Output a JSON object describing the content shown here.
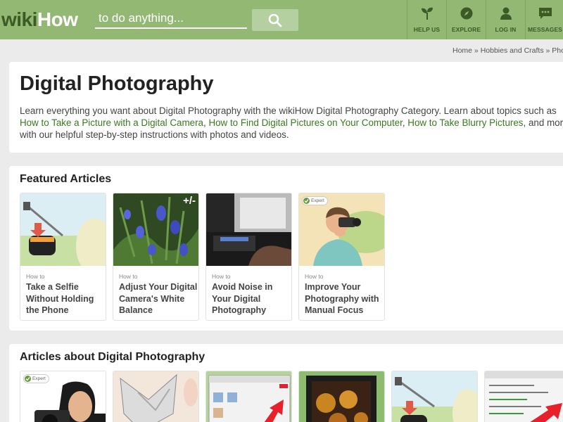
{
  "header": {
    "logo_wiki": "wiki",
    "logo_how": "How",
    "search_placeholder": "to do anything...",
    "nav": [
      {
        "label": "HELP US",
        "icon": "sprout-icon"
      },
      {
        "label": "EXPLORE",
        "icon": "compass-icon"
      },
      {
        "label": "LOG IN",
        "icon": "user-icon"
      },
      {
        "label": "MESSAGES",
        "icon": "chat-icon"
      }
    ]
  },
  "breadcrumb": {
    "home": "Home",
    "sep1": " » ",
    "hobbies": "Hobbies and Crafts",
    "sep2": " » ",
    "current": "Photogr"
  },
  "intro": {
    "title": "Digital Photography",
    "text_1": "Learn everything you want about Digital Photography with the wikiHow Digital Photography Category. Learn about topics such as ",
    "link_1": "How to Take a Picture with a Digital Camera",
    "text_2": ", ",
    "link_2": "How to Find Digital Pictures on Your Computer",
    "text_3": ", ",
    "link_3": "How to Take Blurry Pictures",
    "text_4": ", and more with our helpful step-by-step instructions with photos and videos."
  },
  "featured": {
    "title": "Featured Articles",
    "howto_label": "How to",
    "items": [
      {
        "title": "Take a Selfie Without Holding the Phone",
        "badge": ""
      },
      {
        "title": "Adjust Your Digital Camera's White Balance",
        "badge": "+/-"
      },
      {
        "title": "Avoid Noise in Your Digital Photography",
        "badge": ""
      },
      {
        "title": "Improve Your Photography with Manual Focus",
        "badge": "Expert"
      }
    ]
  },
  "articles": {
    "title": "Articles about Digital Photography",
    "expert_badge": "Expert"
  },
  "colors": {
    "header_bg": "#93b874",
    "link": "#397a1f",
    "logo_dark": "#3b5a26"
  }
}
